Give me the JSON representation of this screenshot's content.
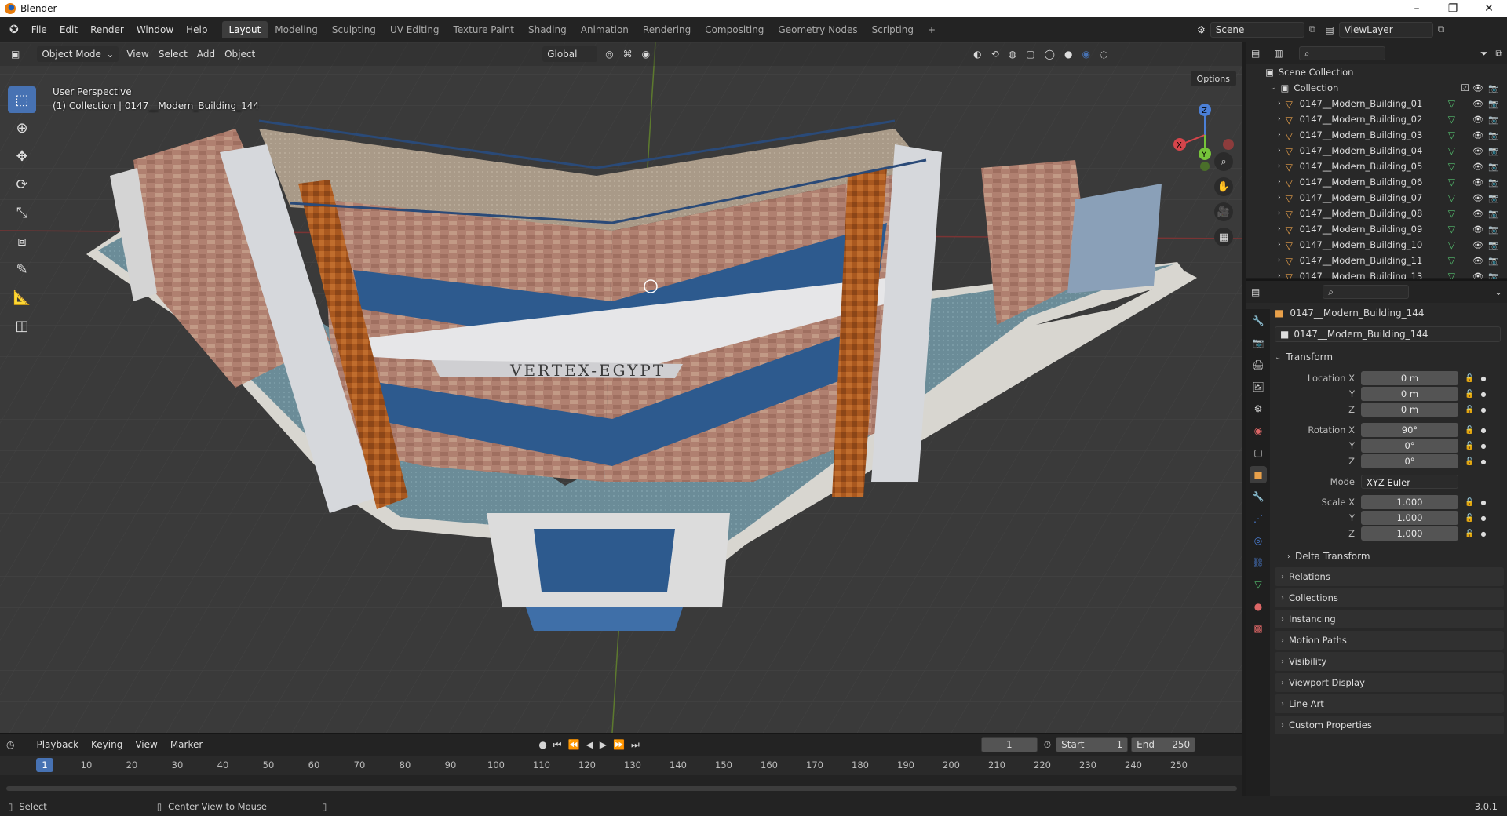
{
  "window": {
    "title": "Blender",
    "min_icon": "minimize-icon",
    "max_icon": "maximize-icon",
    "close_icon": "close-icon"
  },
  "menu": [
    "File",
    "Edit",
    "Render",
    "Window",
    "Help"
  ],
  "workspaces": [
    "Layout",
    "Modeling",
    "Sculpting",
    "UV Editing",
    "Texture Paint",
    "Shading",
    "Animation",
    "Rendering",
    "Compositing",
    "Geometry Nodes",
    "Scripting",
    "+"
  ],
  "active_workspace": "Layout",
  "scene": {
    "label": "Scene"
  },
  "viewlayer": {
    "label": "ViewLayer"
  },
  "viewport": {
    "mode": "Object Mode",
    "menus": [
      "View",
      "Select",
      "Add",
      "Object"
    ],
    "transform_orientation": "Global",
    "options": "Options",
    "perspective": "User Perspective",
    "collection_info": "(1) Collection | 0147__Modern_Building_144",
    "sign_text": "VERTEX-EGYPT"
  },
  "gizmo": {
    "x": "X",
    "y": "Y",
    "z": "Z"
  },
  "outliner": {
    "scene_collection": "Scene Collection",
    "collection": "Collection",
    "items": [
      "0147__Modern_Building_01",
      "0147__Modern_Building_02",
      "0147__Modern_Building_03",
      "0147__Modern_Building_04",
      "0147__Modern_Building_05",
      "0147__Modern_Building_06",
      "0147__Modern_Building_07",
      "0147__Modern_Building_08",
      "0147__Modern_Building_09",
      "0147__Modern_Building_10",
      "0147__Modern_Building_11",
      "0147__Modern_Building_13"
    ]
  },
  "properties": {
    "object_name": "0147__Modern_Building_144",
    "data_name": "0147__Modern_Building_144",
    "transform_title": "Transform",
    "location": {
      "x_label": "Location X",
      "y_label": "Y",
      "z_label": "Z",
      "x": "0 m",
      "y": "0 m",
      "z": "0 m"
    },
    "rotation": {
      "x_label": "Rotation X",
      "y_label": "Y",
      "z_label": "Z",
      "x": "90°",
      "y": "0°",
      "z": "0°"
    },
    "mode_label": "Mode",
    "mode": "XYZ Euler",
    "scale": {
      "x_label": "Scale X",
      "y_label": "Y",
      "z_label": "Z",
      "x": "1.000",
      "y": "1.000",
      "z": "1.000"
    },
    "delta": "Delta Transform",
    "panels": [
      "Relations",
      "Collections",
      "Instancing",
      "Motion Paths",
      "Visibility",
      "Viewport Display",
      "Line Art",
      "Custom Properties"
    ]
  },
  "timeline": {
    "menus": [
      "Playback",
      "Keying",
      "View",
      "Marker"
    ],
    "current_frame": "1",
    "start_label": "Start",
    "start": "1",
    "end_label": "End",
    "end": "250",
    "ruler": [
      "1",
      "10",
      "20",
      "30",
      "40",
      "50",
      "60",
      "70",
      "80",
      "90",
      "100",
      "110",
      "120",
      "130",
      "140",
      "150",
      "160",
      "170",
      "180",
      "190",
      "200",
      "210",
      "220",
      "230",
      "240",
      "250"
    ]
  },
  "status": {
    "select": "Select",
    "center": "Center View to Mouse",
    "version": "3.0.1"
  }
}
